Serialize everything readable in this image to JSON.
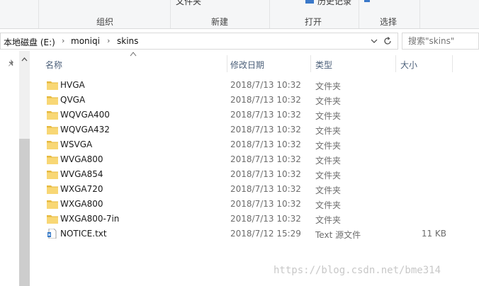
{
  "ribbon": {
    "top_cut_labels": [
      "文件夹",
      "历史记录"
    ],
    "groups": [
      "组织",
      "新建",
      "打开",
      "选择"
    ]
  },
  "address": {
    "crumbs": [
      "本地磁盘 (E:)",
      "moniqi",
      "skins"
    ]
  },
  "search": {
    "placeholder": "搜索\"skins\""
  },
  "columns": {
    "name": "名称",
    "date": "修改日期",
    "type": "类型",
    "size": "大小"
  },
  "files": [
    {
      "name": "HVGA",
      "date": "2018/7/13 10:32",
      "type": "文件夹",
      "size": "",
      "icon": "folder-icon"
    },
    {
      "name": "QVGA",
      "date": "2018/7/13 10:32",
      "type": "文件夹",
      "size": "",
      "icon": "folder-icon"
    },
    {
      "name": "WQVGA400",
      "date": "2018/7/13 10:32",
      "type": "文件夹",
      "size": "",
      "icon": "folder-icon"
    },
    {
      "name": "WQVGA432",
      "date": "2018/7/13 10:32",
      "type": "文件夹",
      "size": "",
      "icon": "folder-icon"
    },
    {
      "name": "WSVGA",
      "date": "2018/7/13 10:32",
      "type": "文件夹",
      "size": "",
      "icon": "folder-icon"
    },
    {
      "name": "WVGA800",
      "date": "2018/7/13 10:32",
      "type": "文件夹",
      "size": "",
      "icon": "folder-icon"
    },
    {
      "name": "WVGA854",
      "date": "2018/7/13 10:32",
      "type": "文件夹",
      "size": "",
      "icon": "folder-icon"
    },
    {
      "name": "WXGA720",
      "date": "2018/7/13 10:32",
      "type": "文件夹",
      "size": "",
      "icon": "folder-icon"
    },
    {
      "name": "WXGA800",
      "date": "2018/7/13 10:32",
      "type": "文件夹",
      "size": "",
      "icon": "folder-icon"
    },
    {
      "name": "WXGA800-7in",
      "date": "2018/7/13 10:32",
      "type": "文件夹",
      "size": "",
      "icon": "folder-icon"
    },
    {
      "name": "NOTICE.txt",
      "date": "2018/7/12 15:29",
      "type": "Text 源文件",
      "size": "11 KB",
      "icon": "text-file-icon"
    }
  ],
  "watermark": "https://blog.csdn.net/bme314",
  "colors": {
    "folder": "#f8d775",
    "folder_dark": "#e6b93e",
    "header_text": "#4c607a"
  }
}
